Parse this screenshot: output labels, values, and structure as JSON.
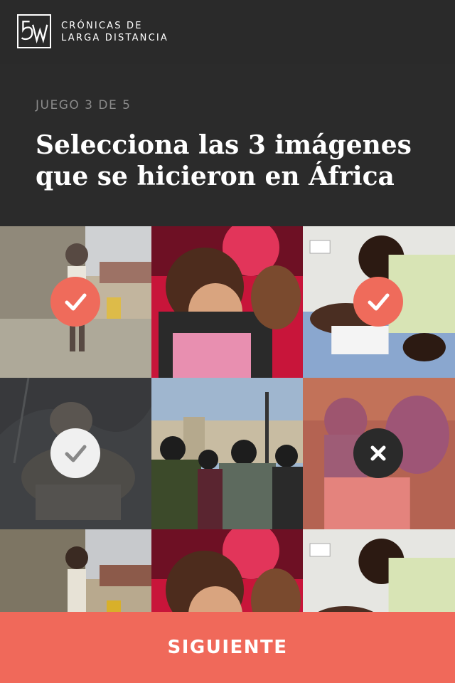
{
  "brand": {
    "name_line1": "CRÓNICAS DE",
    "name_line2": "LARGA DISTANCIA",
    "logo_icon": "5w-logo-icon"
  },
  "game": {
    "step_label": "JUEGO 3 DE 5",
    "title": "Selecciona las 3 imágenes que se hicieron en África"
  },
  "tiles": [
    {
      "scene": "girl-standing-street-debris",
      "state": "selected-correct",
      "icon": "check-icon"
    },
    {
      "scene": "woman-embracing-child",
      "state": "unselected",
      "icon": ""
    },
    {
      "scene": "man-at-hospital-bed",
      "state": "selected-correct",
      "icon": "check-icon"
    },
    {
      "scene": "woman-sleeping-in-tent",
      "state": "selected-muted",
      "icon": "check-icon"
    },
    {
      "scene": "people-at-harbor",
      "state": "unselected",
      "icon": ""
    },
    {
      "scene": "people-with-blankets",
      "state": "selected-wrong",
      "icon": "close-icon"
    },
    {
      "scene": "girl-standing-street-debris",
      "state": "unselected",
      "icon": ""
    },
    {
      "scene": "woman-embracing-child",
      "state": "unselected",
      "icon": ""
    },
    {
      "scene": "man-at-hospital-bed",
      "state": "unselected",
      "icon": ""
    }
  ],
  "cta": {
    "label": "SIGUIENTE"
  },
  "colors": {
    "accent": "#f0695a",
    "background": "#2b2b2b",
    "text": "#ffffff",
    "muted_text": "#8a8a8a"
  }
}
